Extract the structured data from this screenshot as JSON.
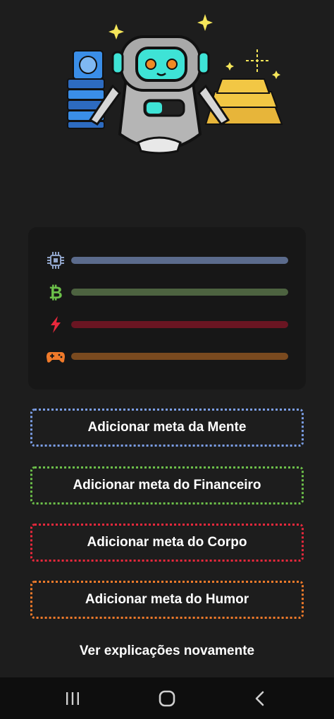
{
  "illustration": {
    "name": "robot-mascot",
    "colors": {
      "robot_body": "#a9a9a9",
      "visor": "#3ee3d6",
      "eyes": "#f08a24",
      "gold": "#f2c744",
      "books": "#3a8ee8",
      "sparkle": "#f5e65a"
    }
  },
  "stats": [
    {
      "name": "mind",
      "icon": "chip-icon",
      "color": "#5b6b8c",
      "icon_color": "#8fa3c8",
      "progress": 0
    },
    {
      "name": "finance",
      "icon": "bitcoin-icon",
      "color": "#4d6340",
      "icon_color": "#6cc04a",
      "progress": 0
    },
    {
      "name": "body",
      "icon": "lightning-icon",
      "color": "#6a1522",
      "icon_color": "#e8283c",
      "progress": 0
    },
    {
      "name": "humor",
      "icon": "gamepad-icon",
      "color": "#7a4a1f",
      "icon_color": "#f07a2a",
      "progress": 0
    }
  ],
  "buttons": {
    "mind": {
      "label": "Adicionar meta da Mente",
      "border": "#7b9ee6"
    },
    "finance": {
      "label": "Adicionar meta do Financeiro",
      "border": "#6cbf4a"
    },
    "body": {
      "label": "Adicionar meta do Corpo",
      "border": "#e8283c"
    },
    "humor": {
      "label": "Adicionar meta do Humor",
      "border": "#f07a2a"
    }
  },
  "explanations_link": "Ver explicações novamente",
  "navbar": {
    "recent": "recent-apps-icon",
    "home": "home-icon",
    "back": "back-icon"
  }
}
